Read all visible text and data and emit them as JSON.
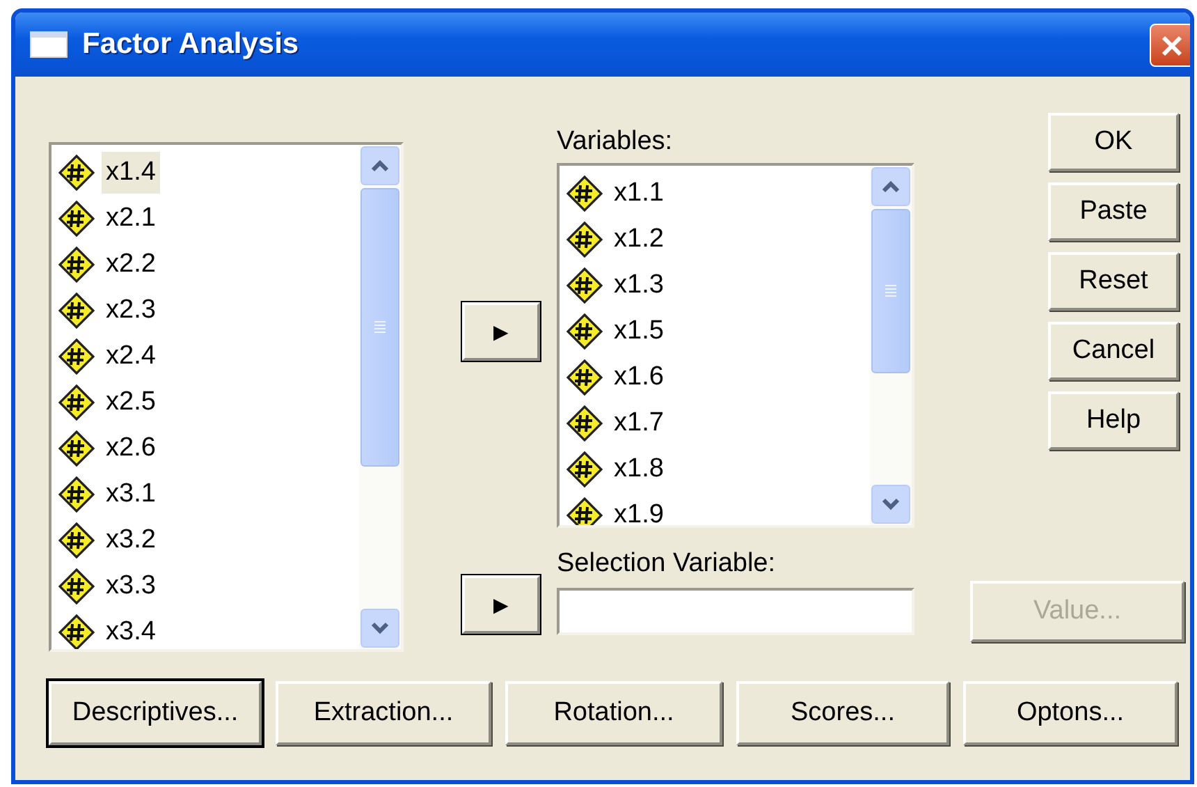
{
  "window": {
    "title": "Factor Analysis"
  },
  "source_list": {
    "items": [
      {
        "label": "x1.4",
        "selected": true
      },
      {
        "label": "x2.1",
        "selected": false
      },
      {
        "label": "x2.2",
        "selected": false
      },
      {
        "label": "x2.3",
        "selected": false
      },
      {
        "label": "x2.4",
        "selected": false
      },
      {
        "label": "x2.5",
        "selected": false
      },
      {
        "label": "x2.6",
        "selected": false
      },
      {
        "label": "x3.1",
        "selected": false
      },
      {
        "label": "x3.2",
        "selected": false
      },
      {
        "label": "x3.3",
        "selected": false
      },
      {
        "label": "x3.4",
        "selected": false
      }
    ]
  },
  "move_buttons": [
    {
      "label": "▶"
    },
    {
      "label": "▶"
    }
  ],
  "variables": {
    "label": "Variables:",
    "items": [
      {
        "label": "x1.1"
      },
      {
        "label": "x1.2"
      },
      {
        "label": "x1.3"
      },
      {
        "label": "x1.5"
      },
      {
        "label": "x1.6"
      },
      {
        "label": "x1.7"
      },
      {
        "label": "x1.8"
      },
      {
        "label": "x1.9"
      }
    ]
  },
  "selection_variable": {
    "label": "Selection Variable:"
  },
  "side_buttons": [
    {
      "label": "OK"
    },
    {
      "label": "Paste"
    },
    {
      "label": "Reset"
    },
    {
      "label": "Cancel"
    },
    {
      "label": "Help"
    }
  ],
  "value_button": {
    "label": "Value...",
    "disabled": true
  },
  "bottom_buttons": [
    {
      "label": "Descriptives...",
      "default": true
    },
    {
      "label": "Extraction...",
      "default": false
    },
    {
      "label": "Rotation...",
      "default": false
    },
    {
      "label": "Scores...",
      "default": false
    },
    {
      "label": "Optons...",
      "default": false
    }
  ]
}
